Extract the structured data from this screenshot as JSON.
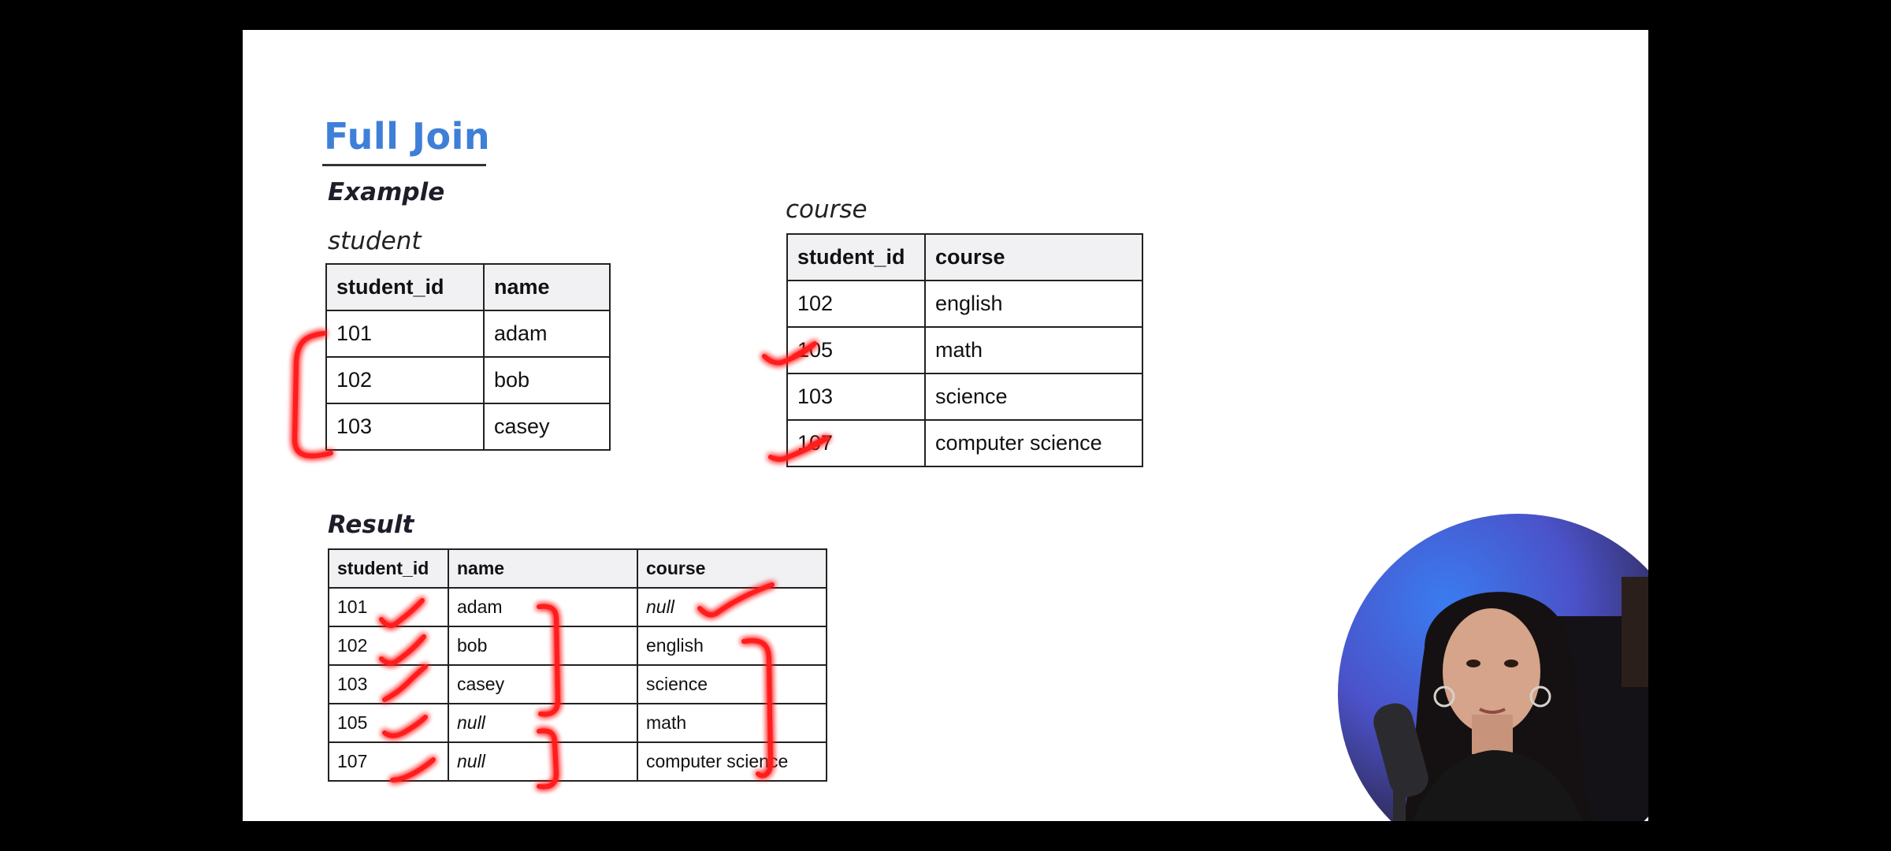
{
  "slide": {
    "title": "Full Join",
    "example_label": "Example",
    "student_label": "student",
    "course_label": "course",
    "result_label": "Result"
  },
  "student_table": {
    "headers": [
      "student_id",
      "name"
    ],
    "rows": [
      [
        "101",
        "adam"
      ],
      [
        "102",
        "bob"
      ],
      [
        "103",
        "casey"
      ]
    ]
  },
  "course_table": {
    "headers": [
      "student_id",
      "course"
    ],
    "rows": [
      [
        "102",
        "english"
      ],
      [
        "105",
        "math"
      ],
      [
        "103",
        "science"
      ],
      [
        "107",
        "computer science"
      ]
    ]
  },
  "result_table": {
    "headers": [
      "student_id",
      "name",
      "course"
    ],
    "rows": [
      [
        "101",
        "adam",
        "null"
      ],
      [
        "102",
        "bob",
        "english"
      ],
      [
        "103",
        "casey",
        "science"
      ],
      [
        "105",
        "null",
        "math"
      ],
      [
        "107",
        "null",
        "computer science"
      ]
    ]
  },
  "annotations": {
    "ink_color": "#ff1a1a",
    "marks": [
      "bracket",
      "checkmark"
    ]
  },
  "webcam": {
    "subject": "presenter-webcam"
  }
}
